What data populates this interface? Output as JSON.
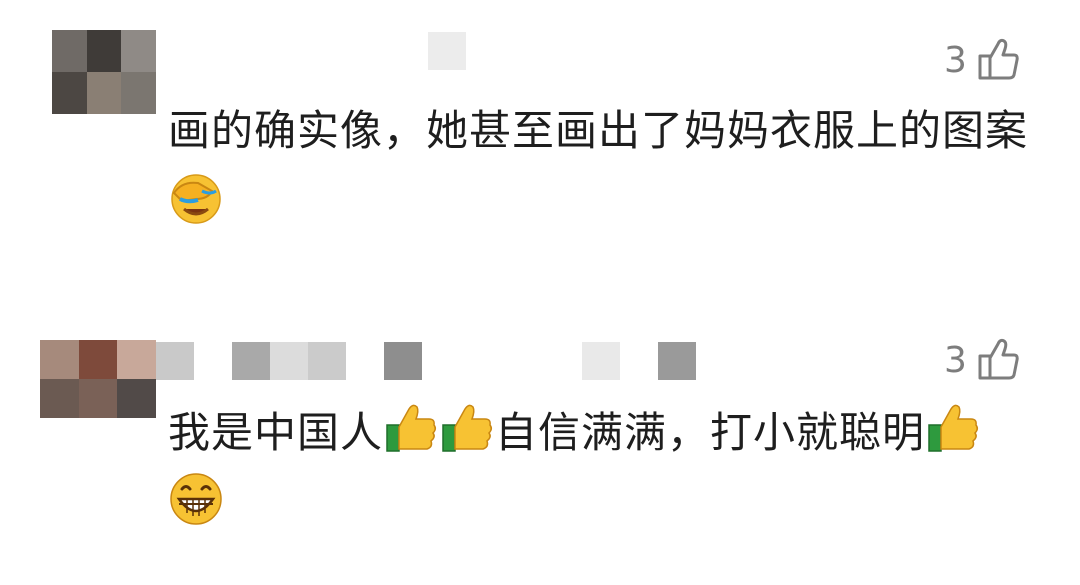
{
  "comments": [
    {
      "like_count": "3",
      "text": "画的确实像，她甚至画出了妈妈衣服上的图案",
      "emojis": [
        "facepalm-emoji"
      ]
    },
    {
      "like_count": "3",
      "segments": [
        "我是中国人",
        "自信满满，打小就聪明"
      ],
      "emojis": [
        "thumbs-up-emoji",
        "grinning-emoji"
      ]
    }
  ],
  "colors": {
    "text": "#1e1e1e",
    "like": "#7d7d7d",
    "background": "#ffffff"
  }
}
